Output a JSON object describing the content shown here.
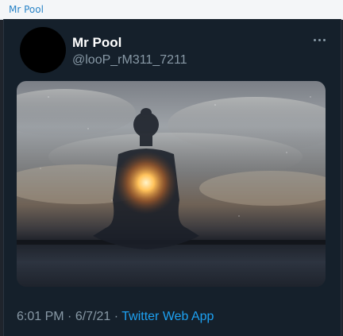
{
  "window": {
    "title": "Mr Pool"
  },
  "tweet": {
    "author_name": "Mr Pool",
    "author_handle": "@looP_rM311_7211",
    "time": "6:01 PM",
    "date": "6/7/21",
    "separator": "·",
    "source": "Twitter Web App"
  },
  "icons": {
    "more": "more-horizontal-icon"
  },
  "colors": {
    "background": "#15202b",
    "link": "#1da1f2",
    "secondary_text": "#8899a6"
  }
}
